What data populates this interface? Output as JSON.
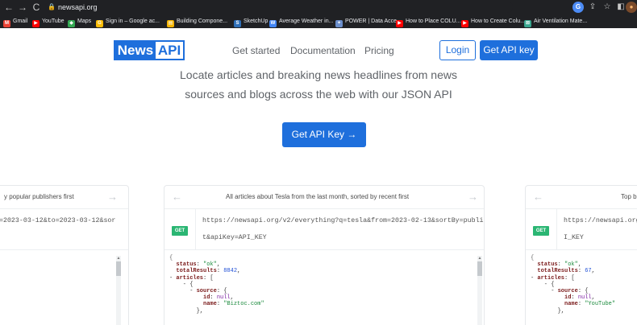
{
  "browser": {
    "url": "newsapi.org",
    "nav": {
      "back": "←",
      "forward": "→",
      "reload": "C"
    },
    "bookmarks": [
      {
        "label": "Gmail",
        "icon": "gmail-icon",
        "color": "#ea4335",
        "glyph": "M"
      },
      {
        "label": "YouTube",
        "icon": "youtube-icon",
        "color": "#ff0000",
        "glyph": "▶"
      },
      {
        "label": "Maps",
        "icon": "maps-icon",
        "color": "#34a853",
        "glyph": "◆"
      },
      {
        "label": "Sign in – Google ac...",
        "icon": "google-icon",
        "color": "#fbbc05",
        "glyph": "G"
      },
      {
        "label": "Building Compone...",
        "icon": "building-icon",
        "color": "#f4b400",
        "glyph": "▤"
      },
      {
        "label": "SketchUp",
        "icon": "sketchup-icon",
        "color": "#2f6fb7",
        "glyph": "S"
      },
      {
        "label": "Average Weather in...",
        "icon": "weather-icon",
        "color": "#4285f4",
        "glyph": "W"
      },
      {
        "label": "POWER | Data Acce...",
        "icon": "nasa-icon",
        "color": "#6b8ecb",
        "glyph": "✦"
      },
      {
        "label": "How to Place COLU...",
        "icon": "youtube-icon",
        "color": "#ff0000",
        "glyph": "▶"
      },
      {
        "label": "How to Create Colu...",
        "icon": "youtube-icon",
        "color": "#ff0000",
        "glyph": "▶"
      },
      {
        "label": "Air Ventilation Mate...",
        "icon": "chart-icon",
        "color": "#3aa68f",
        "glyph": "⊠"
      }
    ]
  },
  "header": {
    "logo_news": "News",
    "logo_api": "API",
    "nav": [
      "Get started",
      "Documentation",
      "Pricing"
    ],
    "login": "Login",
    "get_key": "Get API key"
  },
  "hero": {
    "line1": "Locate articles and breaking news headlines from news",
    "line2": "sources and blogs across the web with our JSON API",
    "cta": "Get API Key →"
  },
  "examples": [
    {
      "title": "y popular publishers first",
      "url_lines": [
        "=2023-03-12&to=2023-03-12&sor"
      ],
      "code": []
    },
    {
      "title": "All articles about Tesla from the last month, sorted by recent first",
      "url_lines": [
        "https://newsapi.org/v2/everything?q=tesla&from=2023-02-13&sortBy=publishedA",
        "t&apiKey=API_KEY"
      ],
      "code": {
        "status": "\"ok\"",
        "totalResults": "8842",
        "articles_key": "articles",
        "source_key": "source",
        "id": "null",
        "name": "\"Biztoc.com\""
      }
    },
    {
      "title": "Top b",
      "url_lines": [
        "https://newsapi.org/v",
        "I_KEY"
      ],
      "code": {
        "status": "\"ok\"",
        "totalResults": "67",
        "articles_key": "articles",
        "source_key": "source",
        "id": "null",
        "name": "\"YouTube\""
      }
    }
  ],
  "badge": "GET",
  "colors": {
    "brand": "#1e6fdc",
    "get_badge": "#2bb673",
    "chrome": "#202124"
  }
}
